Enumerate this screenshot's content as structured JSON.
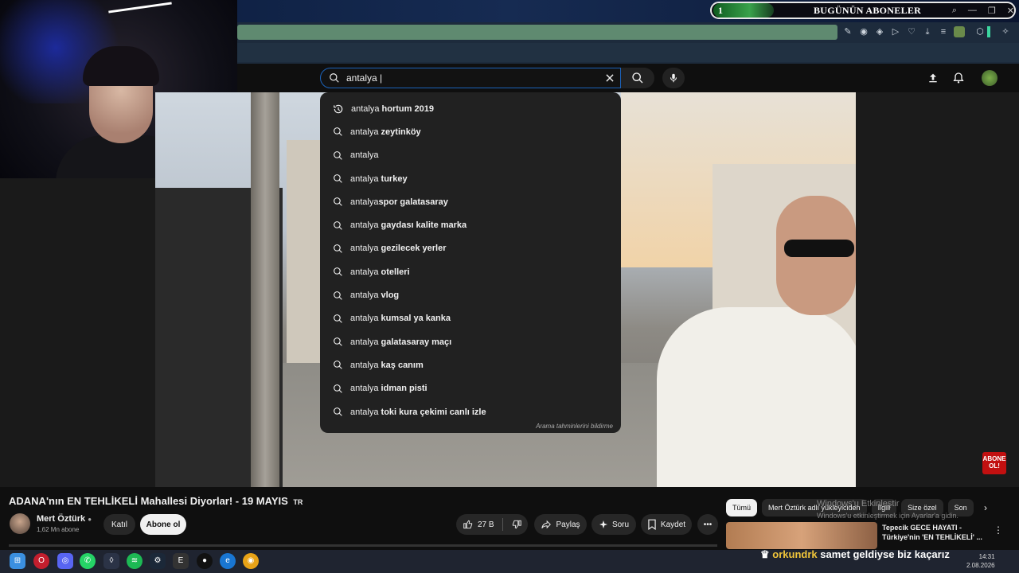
{
  "overlay": {
    "subscriber_count": "1",
    "subscriber_title": "BUGÜNÜN ABONELER",
    "ticker_user": "orkundrk",
    "ticker_message": "samet geldiyse biz kaçarız",
    "abone_badge": "ABONE OL!"
  },
  "search": {
    "query": "antalya |",
    "footer": "Arama tahminlerini bildirme",
    "suggestions": [
      {
        "prefix": "antalya",
        "rest": " hortum 2019",
        "icon": "history-icon"
      },
      {
        "prefix": "antalya",
        "rest": " zeytinköy",
        "icon": "search-icon"
      },
      {
        "prefix": "antalya",
        "rest": "",
        "icon": "search-icon"
      },
      {
        "prefix": "antalya",
        "rest": " turkey",
        "icon": "search-icon"
      },
      {
        "prefix": "antalya",
        "rest": "spor galatasaray",
        "icon": "search-icon"
      },
      {
        "prefix": "antalya",
        "rest": " gaydası kalite marka",
        "icon": "search-icon"
      },
      {
        "prefix": "antalya",
        "rest": " gezilecek yerler",
        "icon": "search-icon"
      },
      {
        "prefix": "antalya",
        "rest": " otelleri",
        "icon": "search-icon"
      },
      {
        "prefix": "antalya",
        "rest": " vlog",
        "icon": "search-icon"
      },
      {
        "prefix": "antalya",
        "rest": " kumsal ya kanka",
        "icon": "search-icon"
      },
      {
        "prefix": "antalya",
        "rest": " galatasaray maçı",
        "icon": "search-icon"
      },
      {
        "prefix": "antalya",
        "rest": " kaş canım",
        "icon": "search-icon"
      },
      {
        "prefix": "antalya",
        "rest": " idman pisti",
        "icon": "search-icon"
      },
      {
        "prefix": "antalya",
        "rest": " toki kura çekimi canlı izle",
        "icon": "search-icon"
      }
    ]
  },
  "video": {
    "title": "ADANA'nın EN TEHLİKELİ Mahallesi Diyorlar! - 19 MAYIS",
    "flag": "TR",
    "channel": "Mert Öztürk",
    "subscribers": "1,62 Mn abone",
    "join_label": "Katıl",
    "subscribe_label": "Abone ol",
    "likes": "27 B",
    "share_label": "Paylaş",
    "ask_label": "Soru",
    "save_label": "Kaydet"
  },
  "chips": [
    "Tümü",
    "Mert Öztürk adlı yükleyiciden",
    "İlgili",
    "Size özel",
    "Son"
  ],
  "related": {
    "title": "Tepecik GECE HAYATI - Türkiye'nin 'EN TEHLİKELİ' ..."
  },
  "watermark": {
    "line1": "Windows'u Etkinleştir",
    "line2": "Windows'u etkinleştirmek için Ayarlar'a gidin."
  },
  "clock": {
    "time": "14:31",
    "date": "2.08.2026"
  },
  "colors": {
    "accent_blue": "#1c62b9",
    "badge_red": "#c21010",
    "sub_green": "#39a24b"
  }
}
